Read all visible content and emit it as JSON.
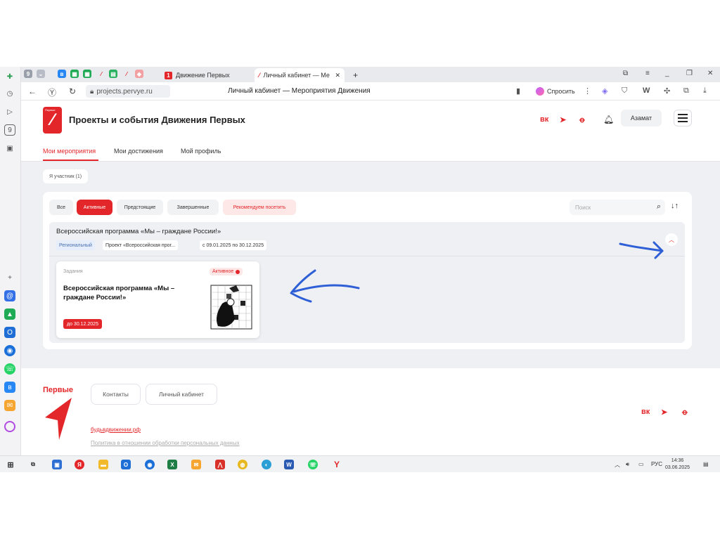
{
  "browser": {
    "tab_counter": "9",
    "tabs": [
      {
        "label": "Движение Первых"
      },
      {
        "label": "Личный кабинет — Ме"
      }
    ],
    "new_tab": "+",
    "url": "projects.pervye.ru",
    "page_title": "Личный кабинет — Мероприятия Движения",
    "ask_label": "Спросить",
    "window_controls": [
      "⧉",
      "≡",
      "_",
      "❐",
      "✕"
    ]
  },
  "site": {
    "brand_small": "Первые",
    "title": "Проекты и события Движения Первых",
    "user_name": "Азамат",
    "social": [
      "вк",
      "telegram",
      "ok"
    ],
    "nav_tabs": [
      {
        "label": "Мои мероприятия",
        "active": true
      },
      {
        "label": "Мои достижения",
        "active": false
      },
      {
        "label": "Мой профиль",
        "active": false
      }
    ],
    "role_chip": "Я участник (1)",
    "filters": [
      {
        "label": "Все",
        "state": "default"
      },
      {
        "label": "Активные",
        "state": "active"
      },
      {
        "label": "Предстоящие",
        "state": "default"
      },
      {
        "label": "Завершенные",
        "state": "default"
      },
      {
        "label": "Рекомендуем посетить",
        "state": "recommended"
      }
    ],
    "search_placeholder": "Поиск",
    "program": {
      "title": "Всероссийская программа «Мы – граждане России!»",
      "tags": [
        "Региональный",
        "Проект «Всероссийская прог...",
        "с 09.01.2025 по 30.12.2025"
      ],
      "task": {
        "kind": "Задания",
        "status": "Активное",
        "title": "Всероссийская программа «Мы – граждане России!»",
        "deadline": "до 30.12.2025"
      }
    },
    "footer": {
      "brand": "Первые",
      "buttons": [
        "Контакты",
        "Личный кабинет"
      ],
      "link": "будьвдвижении.рф",
      "policy": "Политика в отношении обработки персональных данных"
    }
  },
  "taskbar": {
    "tray_text": "РУС",
    "time": "14:36",
    "date": "03.06.2025"
  },
  "colors": {
    "accent": "#e3262a",
    "annotation": "#2f5fd6"
  },
  "icons": [
    "search-icon",
    "sort-icon",
    "bell-icon",
    "menu-icon",
    "back-icon",
    "reload-icon",
    "chevron-up-icon"
  ]
}
